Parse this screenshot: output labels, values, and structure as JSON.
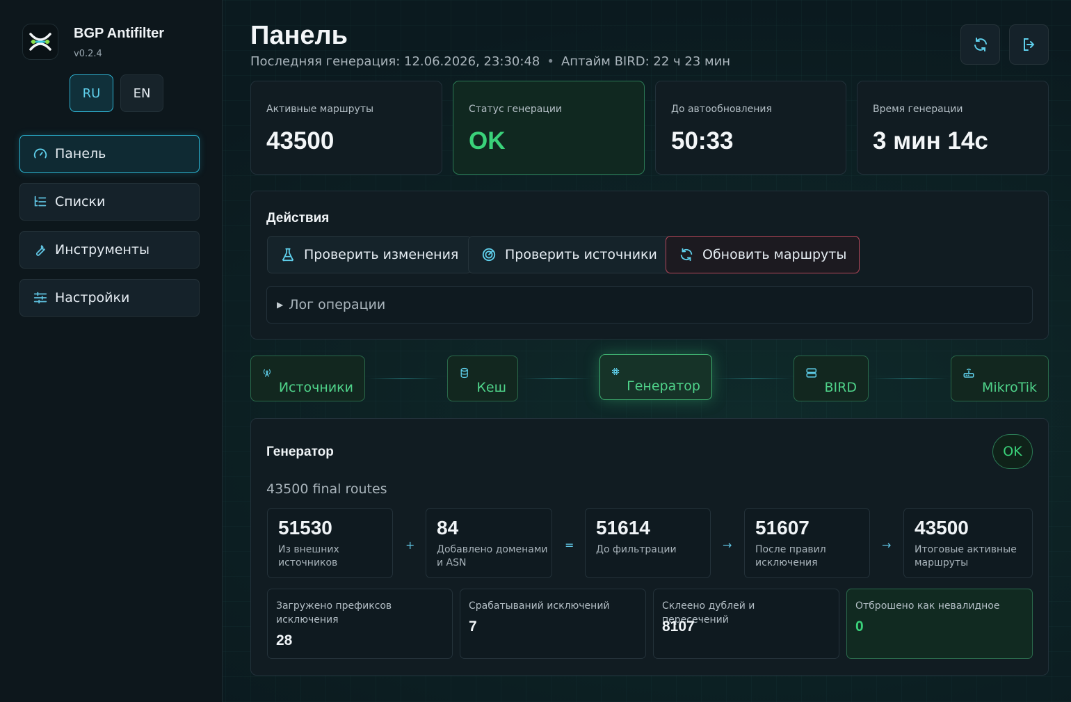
{
  "app": {
    "name": "BGP Antifilter",
    "version": "v0.2.4"
  },
  "lang": {
    "ru": "RU",
    "en": "EN"
  },
  "nav": [
    {
      "label": "Панель",
      "icon": "gauge-icon"
    },
    {
      "label": "Списки",
      "icon": "list-icon"
    },
    {
      "label": "Инструменты",
      "icon": "wrench-icon"
    },
    {
      "label": "Настройки",
      "icon": "sliders-icon"
    }
  ],
  "header": {
    "title": "Панель",
    "last_gen": "Последняя генерация: 12.06.2026, 23:30:48",
    "uptime": "Аптайм BIRD: 22 ч 23 мин"
  },
  "stats": [
    {
      "label": "Активные маршруты",
      "value": "43500"
    },
    {
      "label": "Статус генерации",
      "value": "OK"
    },
    {
      "label": "До автообновления",
      "value": "50:33"
    },
    {
      "label": "Время генерации",
      "value": "3 мин 14с"
    }
  ],
  "actions": {
    "title": "Действия",
    "check_changes": "Проверить изменения",
    "check_sources": "Проверить источники",
    "update_routes": "Обновить маршруты",
    "log": "Лог операции"
  },
  "pipeline": [
    "Источники",
    "Кеш",
    "Генератор",
    "BIRD",
    "MikroTik"
  ],
  "generator": {
    "title": "Генератор",
    "status": "OK",
    "summary": "43500 final routes",
    "flow": [
      {
        "value": "51530",
        "label": "Из внешних источников"
      },
      {
        "value": "84",
        "label": "Добавлено доменами и ASN"
      },
      {
        "value": "51614",
        "label": "До фильтрации"
      },
      {
        "value": "51607",
        "label": "После правил исключения"
      },
      {
        "value": "43500",
        "label": "Итоговые активные маршруты"
      }
    ],
    "ops": [
      "+",
      "=",
      "→",
      "→"
    ],
    "metrics": [
      {
        "label": "Загружено префиксов исключения",
        "value": "28"
      },
      {
        "label": "Срабатываний исключений",
        "value": "7"
      },
      {
        "label": "Склеено дублей и пересечений",
        "value": "8107"
      },
      {
        "label": "Отброшено как невалидное",
        "value": "0"
      }
    ]
  },
  "colors": {
    "accent": "#2bb6d4",
    "ok": "#3ad27a",
    "danger": "#b6475a"
  }
}
